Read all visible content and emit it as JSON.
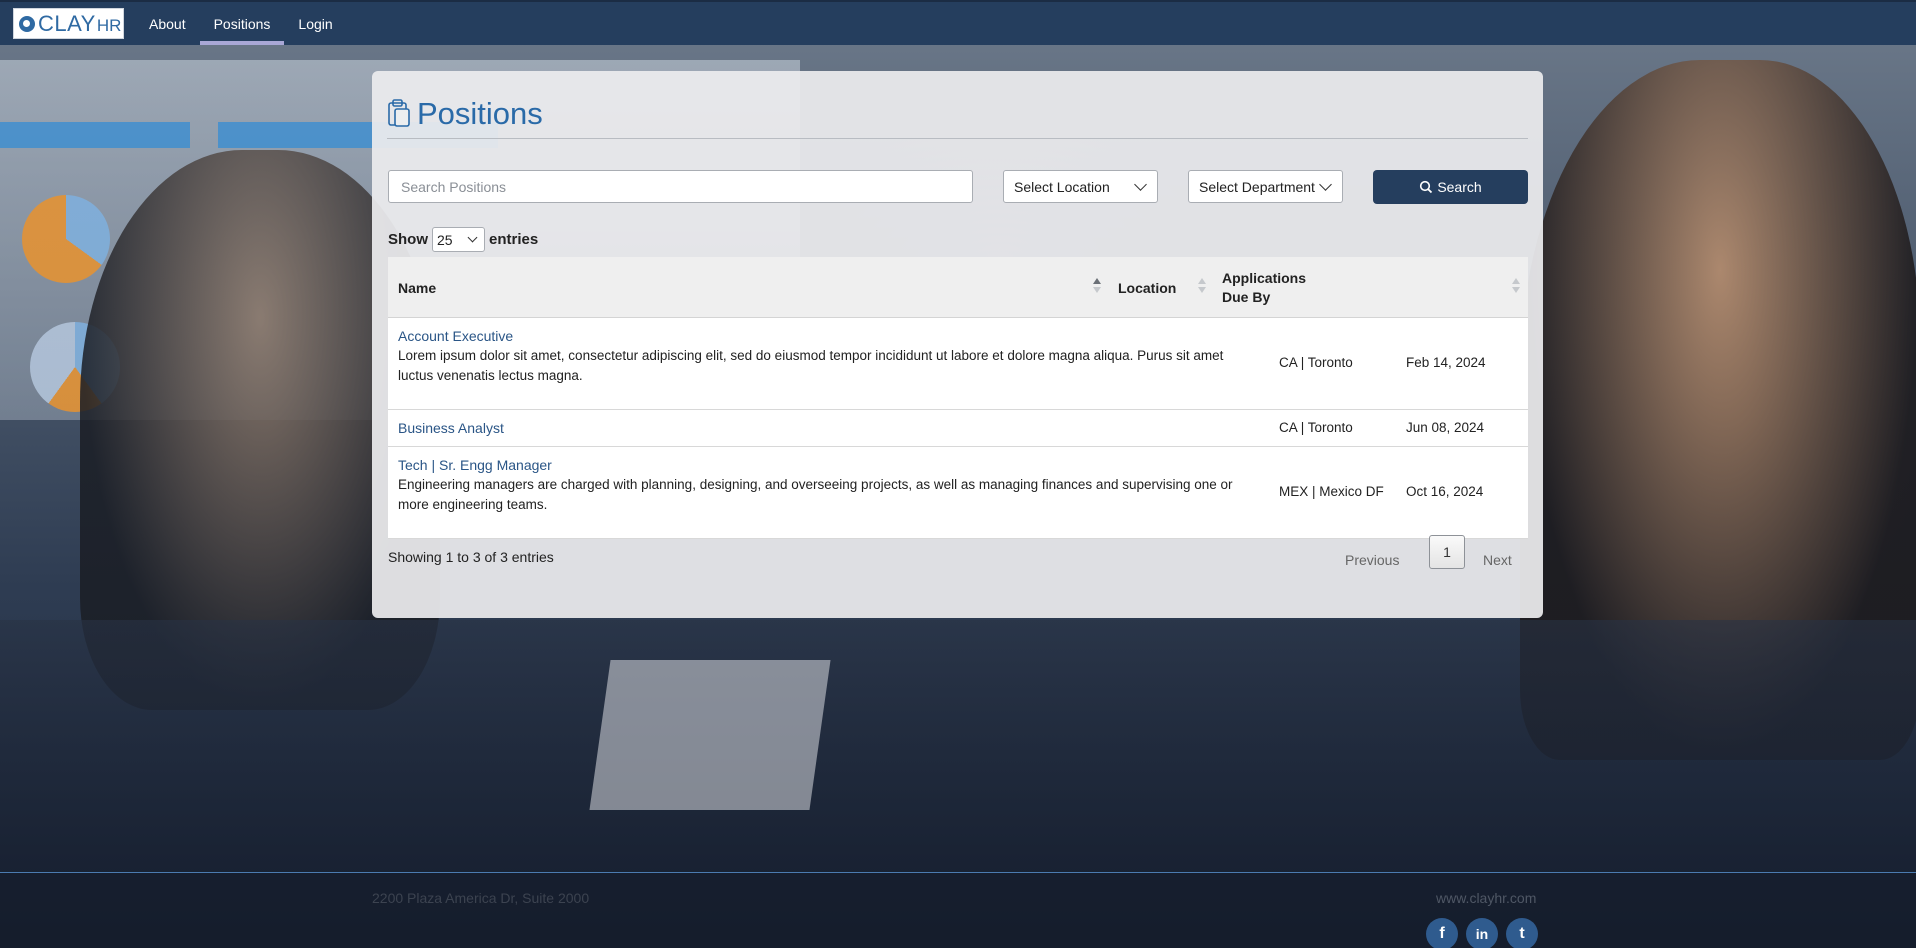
{
  "nav": {
    "logo_main": "CLAY",
    "logo_sub": "HR",
    "links": [
      "About",
      "Positions",
      "Login"
    ]
  },
  "page": {
    "title": "Positions"
  },
  "filters": {
    "search_placeholder": "Search Positions",
    "location": "Select Location",
    "department": "Select Department",
    "search_button": "Search"
  },
  "length": {
    "show": "Show",
    "value": "25",
    "entries": "entries"
  },
  "table": {
    "headers": [
      "Name",
      "Location",
      "Applications Due By"
    ],
    "rows": [
      {
        "title": "Account Executive",
        "description": "Lorem ipsum dolor sit amet, consectetur adipiscing elit, sed do eiusmod tempor incididunt ut labore et dolore magna aliqua. Purus sit amet luctus venenatis lectus magna.",
        "location": "CA | Toronto",
        "due": "Feb 14, 2024"
      },
      {
        "title": "Business Analyst",
        "description": "",
        "location": "CA | Toronto",
        "due": "Jun 08, 2024"
      },
      {
        "title": "Tech | Sr. Engg Manager",
        "description": "Engineering managers are charged with planning, designing, and overseeing projects, as well as managing finances and supervising one or more engineering teams.",
        "location": "MEX | Mexico DF",
        "due": "Oct 16, 2024"
      }
    ],
    "info": "Showing 1 to 3 of 3 entries"
  },
  "pagination": {
    "previous": "Previous",
    "current": "1",
    "next": "Next"
  },
  "footer": {
    "address": "2200 Plaza America Dr, Suite 2000",
    "website": "www.clayhr.com",
    "socials": [
      {
        "icon": "facebook-icon",
        "glyph": "f"
      },
      {
        "icon": "linkedin-icon",
        "glyph": "in"
      },
      {
        "icon": "twitter-icon",
        "glyph": "t"
      }
    ]
  },
  "colors": {
    "navbar": "#253e5e",
    "accent": "#2a6aa8",
    "link": "#2a5586"
  }
}
